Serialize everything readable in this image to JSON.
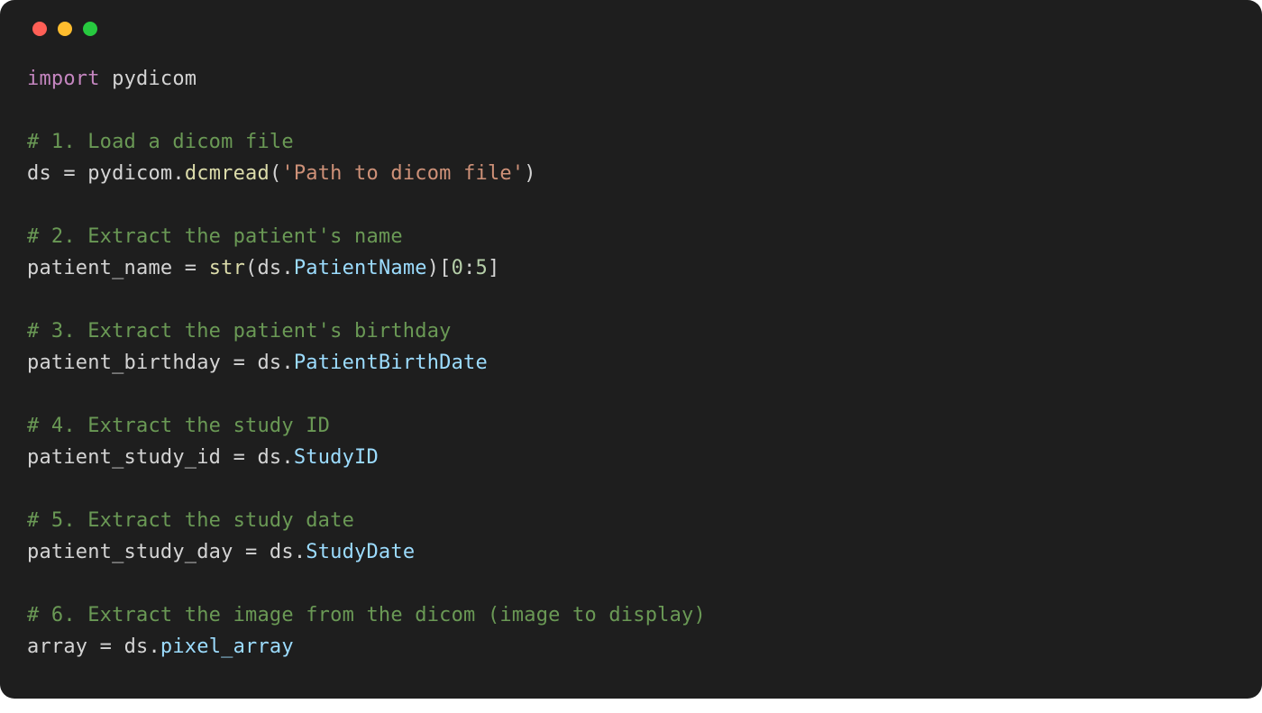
{
  "window": {
    "traffic_lights": [
      "close",
      "minimize",
      "zoom"
    ]
  },
  "code": {
    "line1": {
      "kw": "import",
      "sp": " ",
      "mod": "pydicom"
    },
    "line2": {
      "blank": ""
    },
    "line3": {
      "comment": "# 1. Load a dicom file"
    },
    "line4": {
      "var": "ds",
      "eq": " = ",
      "obj": "pydicom",
      "dot": ".",
      "fn": "dcmread",
      "lp": "(",
      "str": "'Path to dicom file'",
      "rp": ")"
    },
    "line5": {
      "blank": ""
    },
    "line6": {
      "comment": "# 2. Extract the patient's name"
    },
    "line7": {
      "var": "patient_name",
      "eq": " = ",
      "fn": "str",
      "lp": "(",
      "obj": "ds",
      "dot": ".",
      "attr": "PatientName",
      "rp": ")[",
      "n1": "0",
      "colon": ":",
      "n2": "5",
      "rb": "]"
    },
    "line8": {
      "blank": ""
    },
    "line9": {
      "comment": "# 3. Extract the patient's birthday"
    },
    "line10": {
      "var": "patient_birthday",
      "eq": " = ",
      "obj": "ds",
      "dot": ".",
      "attr": "PatientBirthDate"
    },
    "line11": {
      "blank": ""
    },
    "line12": {
      "comment": "# 4. Extract the study ID"
    },
    "line13": {
      "var": "patient_study_id",
      "eq": " = ",
      "obj": "ds",
      "dot": ".",
      "attr": "StudyID"
    },
    "line14": {
      "blank": ""
    },
    "line15": {
      "comment": "# 5. Extract the study date"
    },
    "line16": {
      "var": "patient_study_day",
      "eq": " = ",
      "obj": "ds",
      "dot": ".",
      "attr": "StudyDate"
    },
    "line17": {
      "blank": ""
    },
    "line18": {
      "comment": "# 6. Extract the image from the dicom (image to display)"
    },
    "line19": {
      "var": "array",
      "eq": " = ",
      "obj": "ds",
      "dot": ".",
      "attr": "pixel_array"
    }
  }
}
